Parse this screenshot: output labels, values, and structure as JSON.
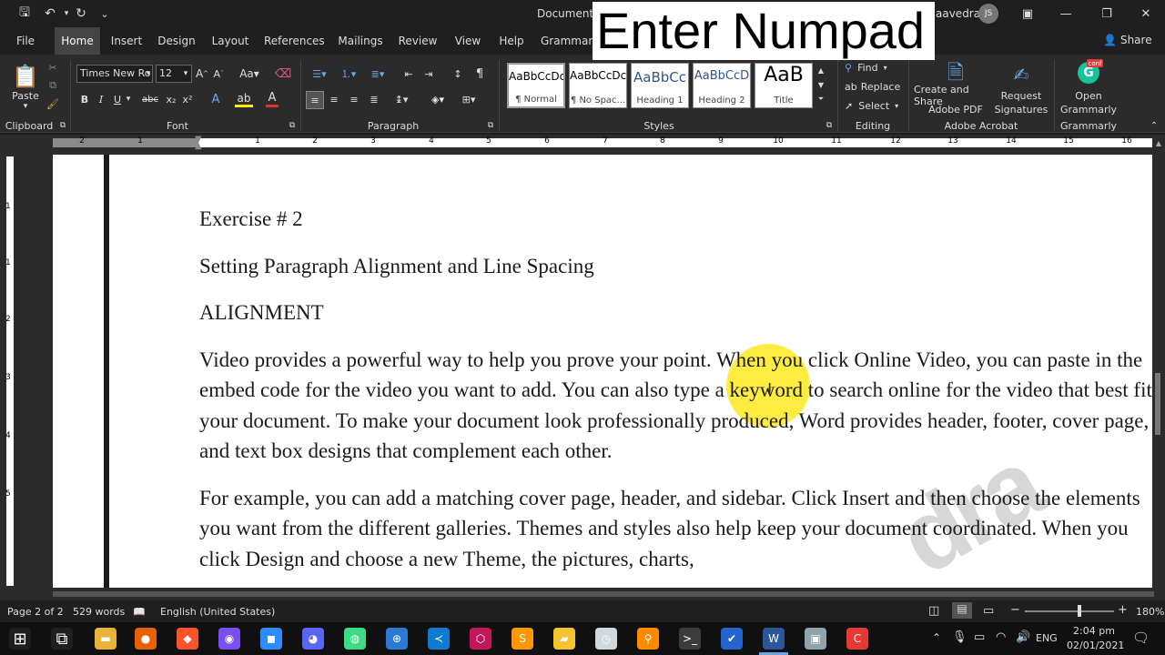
{
  "window": {
    "title": "Document1",
    "overlay_text": "Enter Numpad",
    "user": "aavedra",
    "avatar": "JS",
    "min": "—",
    "restore": "❐",
    "close": "✕",
    "ribbon_display": "▣"
  },
  "quick_access": {
    "save_icon": "save-icon",
    "undo_icon": "undo-icon",
    "redo_icon": "redo-icon",
    "more": "⌄"
  },
  "tabs": [
    "File",
    "Home",
    "Insert",
    "Design",
    "Layout",
    "References",
    "Mailings",
    "Review",
    "View",
    "Help",
    "Grammarly"
  ],
  "active_tab": "Home",
  "share_label": "Share",
  "ribbon": {
    "clipboard": {
      "paste": "Paste",
      "label": "Clipboard"
    },
    "font": {
      "name": "Times New Ro",
      "size": "12",
      "label": "Font",
      "bold": "B",
      "italic": "I",
      "underline": "U",
      "strike": "abc",
      "sub": "x₂",
      "sup": "x²"
    },
    "paragraph": {
      "label": "Paragraph"
    },
    "styles": {
      "label": "Styles",
      "tiles": [
        {
          "preview": "AaBbCcDc",
          "name": "¶ Normal"
        },
        {
          "preview": "AaBbCcDc",
          "name": "¶ No Spac..."
        },
        {
          "preview": "AaBbCc",
          "name": "Heading 1"
        },
        {
          "preview": "AaBbCcD",
          "name": "Heading 2"
        },
        {
          "preview": "AaB",
          "name": "Title"
        }
      ]
    },
    "editing": {
      "find": "Find",
      "replace": "Replace",
      "select": "Select",
      "label": "Editing"
    },
    "adobe": {
      "create": "Create and Share",
      "create2": "Adobe PDF",
      "request": "Request",
      "request2": "Signatures",
      "label": "Adobe Acrobat"
    },
    "grammarly": {
      "open": "Open",
      "open2": "Grammarly",
      "label": "Grammarly",
      "badge": "conf"
    }
  },
  "ruler": {
    "numbers": [
      "2",
      "1",
      "1",
      "2",
      "3",
      "4",
      "5",
      "6",
      "7",
      "8",
      "9",
      "10",
      "11",
      "12",
      "13",
      "14",
      "15",
      "16"
    ]
  },
  "vruler": {
    "numbers": [
      "1",
      "1",
      "2",
      "3",
      "4",
      "5"
    ]
  },
  "document": {
    "heading1": "Exercise # 2",
    "heading2": "Setting Paragraph Alignment and Line Spacing",
    "heading3": "ALIGNMENT",
    "para1": "Video provides a powerful way to help you prove your point. When you click Online Video, you can paste in the embed code for the video you want to add. You can also type a keyword to search online for the video that best fits your document. To make your document look professionally produced, Word provides header, footer, cover page, and text box designs that complement each other.",
    "para2": "For example, you can add a matching cover page, header, and sidebar. Click Insert and then choose the elements you want from the different galleries. Themes and styles also help keep your document coordinated. When you click Design and choose a new Theme, the pictures, charts,",
    "watermark": "dra"
  },
  "status": {
    "page": "Page 2 of 2",
    "words": "529 words",
    "language": "English (United States)",
    "zoom": "180%",
    "minus": "−",
    "plus": "+"
  },
  "taskbar": {
    "time": "2:04 pm",
    "date": "02/01/2021",
    "lang": "ENG",
    "apps": [
      {
        "name": "start-icon",
        "color": "#1f1f1f",
        "glyph": "⊞"
      },
      {
        "name": "task-view-icon",
        "color": "#1f1f1f",
        "glyph": "⧉"
      },
      {
        "name": "file-explorer-icon",
        "color": "#e8b33a",
        "glyph": "▬"
      },
      {
        "name": "firefox-icon",
        "color": "#e66000",
        "glyph": "●"
      },
      {
        "name": "brave-icon",
        "color": "#fb542b",
        "glyph": "◆"
      },
      {
        "name": "messenger-icon",
        "color": "#7b4ef2",
        "glyph": "◉"
      },
      {
        "name": "zoom-icon",
        "color": "#2d8cff",
        "glyph": "◼"
      },
      {
        "name": "discord-icon",
        "color": "#5865f2",
        "glyph": "◕"
      },
      {
        "name": "android-icon",
        "color": "#3ddc84",
        "glyph": "◍"
      },
      {
        "name": "network-app-icon",
        "color": "#2a7ad5",
        "glyph": "⊕"
      },
      {
        "name": "vscode-icon",
        "color": "#0e7ad1",
        "glyph": "≺"
      },
      {
        "name": "app-hex-icon",
        "color": "#c2185b",
        "glyph": "⬡"
      },
      {
        "name": "sublime-icon",
        "color": "#ff9800",
        "glyph": "S"
      },
      {
        "name": "sticky-notes-icon",
        "color": "#f4c430",
        "glyph": "▰"
      },
      {
        "name": "clock-app-icon",
        "color": "#cfd8dc",
        "glyph": "◷"
      },
      {
        "name": "search-app-icon",
        "color": "#ff8a00",
        "glyph": "⚲"
      },
      {
        "name": "terminal-icon",
        "color": "#3c3c3c",
        "glyph": ">_"
      },
      {
        "name": "todo-icon",
        "color": "#2564cf",
        "glyph": "✔"
      },
      {
        "name": "word-icon",
        "color": "#2b579a",
        "glyph": "W"
      },
      {
        "name": "remote-desktop-icon",
        "color": "#90a4ae",
        "glyph": "▣"
      },
      {
        "name": "camtasia-icon",
        "color": "#e53935",
        "glyph": "C"
      }
    ]
  },
  "colors": {
    "accent": "#2b579a",
    "highlight": "#ffe600",
    "ribbon_bg": "#2b2b2b",
    "title_bg": "#1f1f1f"
  }
}
